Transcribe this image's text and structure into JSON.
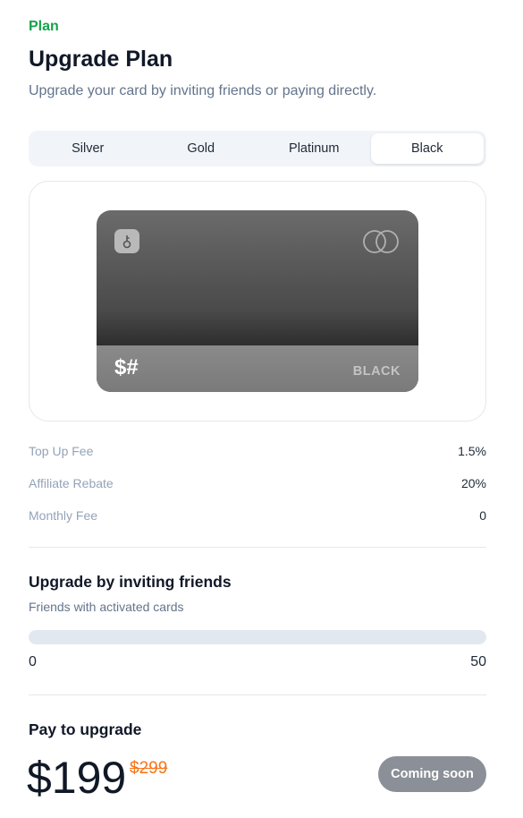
{
  "header": {
    "eyebrow": "Plan",
    "title": "Upgrade Plan",
    "subtitle": "Upgrade your card by inviting friends or paying directly."
  },
  "tabs": [
    {
      "label": "Silver",
      "active": false
    },
    {
      "label": "Gold",
      "active": false
    },
    {
      "label": "Platinum",
      "active": false
    },
    {
      "label": "Black",
      "active": true
    }
  ],
  "card": {
    "brand": "$#",
    "tier": "BLACK",
    "chip_icon": "key-icon",
    "network_icon": "rings-icon"
  },
  "fees": [
    {
      "label": "Top Up Fee",
      "value": "1.5%"
    },
    {
      "label": "Affiliate Rebate",
      "value": "20%"
    },
    {
      "label": "Monthly Fee",
      "value": "0"
    }
  ],
  "invite": {
    "title": "Upgrade by inviting friends",
    "subtitle": "Friends with activated cards",
    "progress": 0,
    "min_label": "0",
    "max_label": "50"
  },
  "pay": {
    "title": "Pay to upgrade",
    "price": "$199",
    "old_price": "$299",
    "button_label": "Coming soon"
  },
  "colors": {
    "accent": "#16a34a",
    "strike": "#f97316",
    "button_disabled": "#8b8f97"
  }
}
